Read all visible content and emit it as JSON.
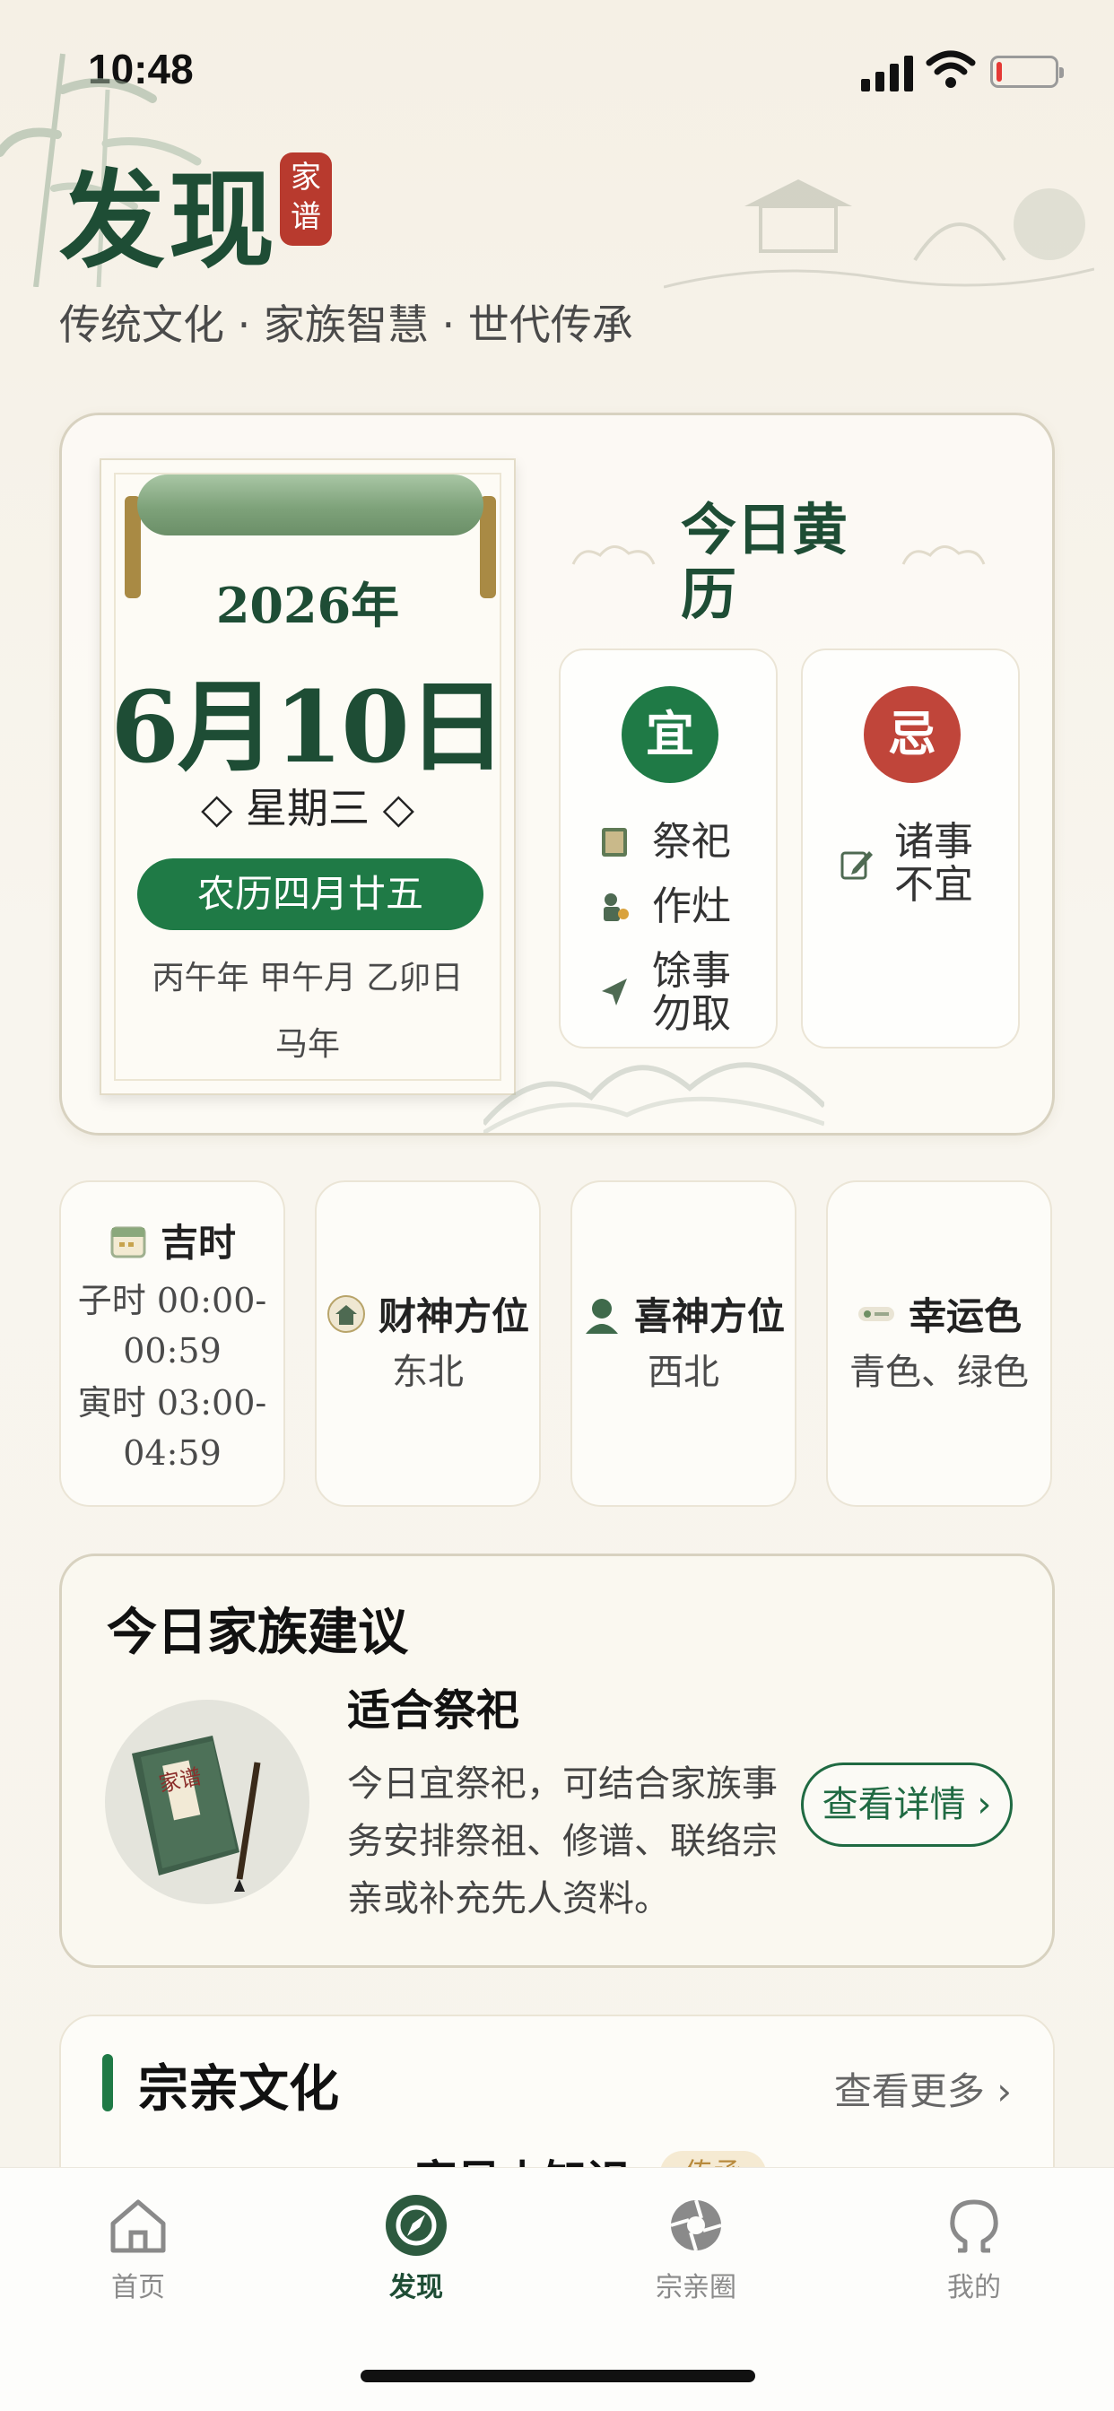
{
  "status_bar": {
    "time": "10:48"
  },
  "header": {
    "title": "发现",
    "seal_line1": "家",
    "seal_line2": "谱",
    "subtitle": "传统文化 · 家族智慧 · 世代传承"
  },
  "calendar": {
    "year": "2026年",
    "date": "6月10日",
    "weekday": "◇ 星期三 ◇",
    "lunar": "农历四月廿五",
    "ganzhi": "丙午年 甲午月 乙卯日",
    "zodiac": "马年"
  },
  "almanac": {
    "title": "今日黄历",
    "yi": {
      "badge": "宜",
      "items": [
        "祭祀",
        "作灶",
        "馀事勿取"
      ]
    },
    "ji": {
      "badge": "忌",
      "items": [
        "诸事不宜"
      ]
    },
    "colors": {
      "yi": "#1f7a46",
      "ji": "#c0453a"
    }
  },
  "info_cards": [
    {
      "label": "吉时",
      "icon": "calendar-icon",
      "lines": [
        "子时 00:00-",
        "00:59",
        "寅时 03:00-",
        "04:59"
      ]
    },
    {
      "label": "财神方位",
      "icon": "fortune-god-icon",
      "lines": [
        "东北"
      ]
    },
    {
      "label": "喜神方位",
      "icon": "joy-god-icon",
      "lines": [
        "西北"
      ]
    },
    {
      "label": "幸运色",
      "icon": "color-swatch-icon",
      "lines": [
        "青色、绿色"
      ]
    }
  ],
  "advice": {
    "title": "今日家族建议",
    "book_label": "家谱",
    "subtitle": "适合祭祀",
    "description": "今日宜祭祀，可结合家族事务安排祭祖、修谱、联络宗亲或补充先人资料。",
    "button": "查看详情 ›"
  },
  "culture": {
    "title": "宗亲文化",
    "more": "查看更多 ›",
    "item_title": "家风小知识",
    "item_tag": "传承"
  },
  "tabbar": [
    {
      "label": "首页",
      "icon": "home-icon",
      "active": false
    },
    {
      "label": "发现",
      "icon": "compass-icon",
      "active": true
    },
    {
      "label": "宗亲圈",
      "icon": "aperture-icon",
      "active": false
    },
    {
      "label": "我的",
      "icon": "profile-icon",
      "active": false
    }
  ],
  "theme": {
    "primary_green": "#1e4d35",
    "accent_green": "#1f7a46",
    "seal_red": "#b83a2e"
  }
}
